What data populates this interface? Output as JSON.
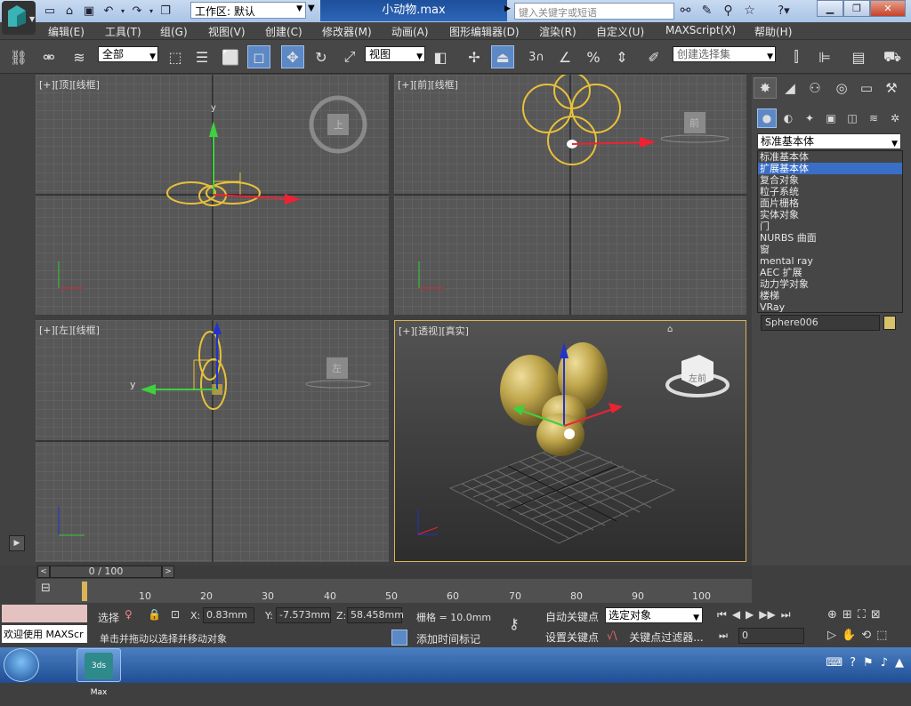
{
  "title": {
    "logo_label": "3ds Max",
    "workspace": "工作区: 默认",
    "filename": "小动物.max",
    "search_placeholder": "键入关键字或短语"
  },
  "menu": [
    "编辑(E)",
    "工具(T)",
    "组(G)",
    "视图(V)",
    "创建(C)",
    "修改器(M)",
    "动画(A)",
    "图形编辑器(D)",
    "渲染(R)",
    "自定义(U)",
    "MAXScript(X)",
    "帮助(H)"
  ],
  "toolbar": {
    "filter": "全部",
    "refcoord": "视图",
    "snap_num": "3",
    "selset_placeholder": "创建选择集"
  },
  "viewports": {
    "top": {
      "label": "[+][顶][线框]",
      "cube": "上"
    },
    "front": {
      "label": "[+][前][线框]",
      "cube": "前"
    },
    "left": {
      "label": "[+][左][线框]",
      "cube": "左"
    },
    "persp": {
      "label": "[+][透视][真实]",
      "cube": "左前"
    }
  },
  "command_panel": {
    "category": "标准基本体",
    "category_options": [
      "标准基本体",
      "扩展基本体",
      "复合对象",
      "粒子系统",
      "面片栅格",
      "实体对象",
      "门",
      "NURBS 曲面",
      "窗",
      "mental ray",
      "AEC 扩展",
      "动力学对象",
      "楼梯",
      "VRay"
    ],
    "selected_option_index": 1,
    "object_name": "Sphere006",
    "swatch_color": "#d7c16a"
  },
  "timeline": {
    "frame": "0 / 100",
    "ticks": [
      "10",
      "20",
      "30",
      "40",
      "50",
      "60",
      "70",
      "80",
      "90",
      "100"
    ]
  },
  "status": {
    "maxscript_prompt": "欢迎使用 MAXScr",
    "sel_label": "选择",
    "x_label": "X:",
    "x": "0.83mm",
    "y_label": "Y:",
    "y": "-7.573mm",
    "z_label": "Z:",
    "z": "58.458mm",
    "grid": "栅格 = 10.0mm",
    "prompt": "单击并拖动以选择并移动对象",
    "add_time_tag": "添加时间标记",
    "auto_key": "自动关键点",
    "set_key": "设置关键点",
    "key_mode": "选定对象",
    "key_filters": "关键点过滤器...",
    "frame_field": "0"
  },
  "colors": {
    "accent": "#5c89c5",
    "selection_wire": "#e8c13a",
    "viewport_bg": "#575757"
  }
}
